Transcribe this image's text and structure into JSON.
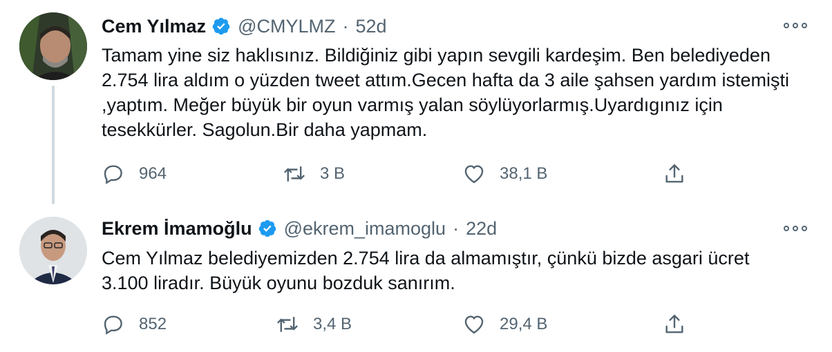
{
  "tweets": [
    {
      "name": "Cem Yılmaz",
      "handle": "@CMYLMZ",
      "separator": "·",
      "time": "52d",
      "text": "Tamam yine siz haklısınız. Bildiğiniz gibi yapın sevgili kardeşim. Ben belediyeden 2.754 lira aldım o yüzden tweet attım.Gecen hafta da 3  aile şahsen yardım istemişti ,yaptım. Meğer büyük bir oyun varmış yalan söylüyorlarmış.Uyardıgınız için tesekkürler. Sagolun.Bir daha yapmam.",
      "replies": "964",
      "retweets": "3 B",
      "likes": "38,1 B"
    },
    {
      "name": "Ekrem İmamoğlu",
      "handle": "@ekrem_imamoglu",
      "separator": "·",
      "time": "22d",
      "text": "Cem Yılmaz belediyemizden 2.754 lira da almamıştır, çünkü bizde asgari ücret 3.100 liradır. Büyük oyunu bozduk sanırım.",
      "replies": "852",
      "retweets": "3,4 B",
      "likes": "29,4 B"
    }
  ],
  "icons": {
    "verified": "verified-badge-icon",
    "more": "more-options-icon",
    "reply": "reply-icon",
    "retweet": "retweet-icon",
    "like": "like-icon",
    "share": "share-icon"
  },
  "colors": {
    "verified": "#1d9bf0",
    "secondary_text": "#536471",
    "primary_text": "#0f1419",
    "thread_line": "#cfd9de"
  }
}
